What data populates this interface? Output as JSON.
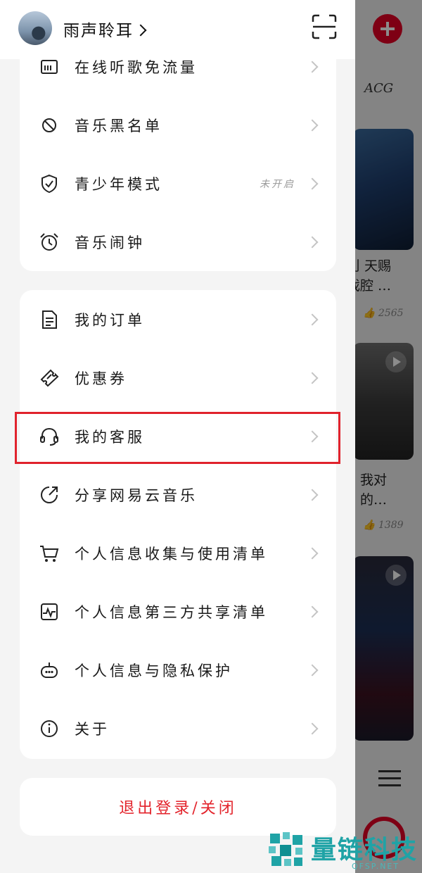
{
  "header": {
    "username": "雨声聆耳"
  },
  "group1": {
    "items": [
      {
        "label": "在线听歌免流量",
        "icon": "sim-card-icon"
      },
      {
        "label": "音乐黑名单",
        "icon": "block-icon"
      },
      {
        "label": "青少年模式",
        "icon": "shield-check-icon",
        "status": "未开启"
      },
      {
        "label": "音乐闹钟",
        "icon": "alarm-clock-icon"
      }
    ]
  },
  "group2": {
    "items": [
      {
        "label": "我的订单",
        "icon": "document-icon"
      },
      {
        "label": "优惠券",
        "icon": "coupon-icon"
      },
      {
        "label": "我的客服",
        "icon": "headset-icon"
      },
      {
        "label": "分享网易云音乐",
        "icon": "share-icon"
      },
      {
        "label": "个人信息收集与使用清单",
        "icon": "cart-icon"
      },
      {
        "label": "个人信息第三方共享清单",
        "icon": "chart-doc-icon"
      },
      {
        "label": "个人信息与隐私保护",
        "icon": "robot-icon"
      },
      {
        "label": "关于",
        "icon": "info-icon"
      }
    ]
  },
  "logout": {
    "label": "退出登录/关闭"
  },
  "background": {
    "tab_label": "ACG",
    "cards": [
      {
        "title_line1": "刂 天赐",
        "title_line2": "戏腔 …",
        "likes": "2565"
      },
      {
        "title_line1": "我对",
        "title_line2": "的…",
        "likes": "1389"
      }
    ]
  },
  "watermark": {
    "name": "量链科技",
    "url": "QFSP.NET"
  },
  "colors": {
    "accent": "#e60026",
    "highlight": "#e0222c",
    "watermark": "#1fa3a6"
  }
}
